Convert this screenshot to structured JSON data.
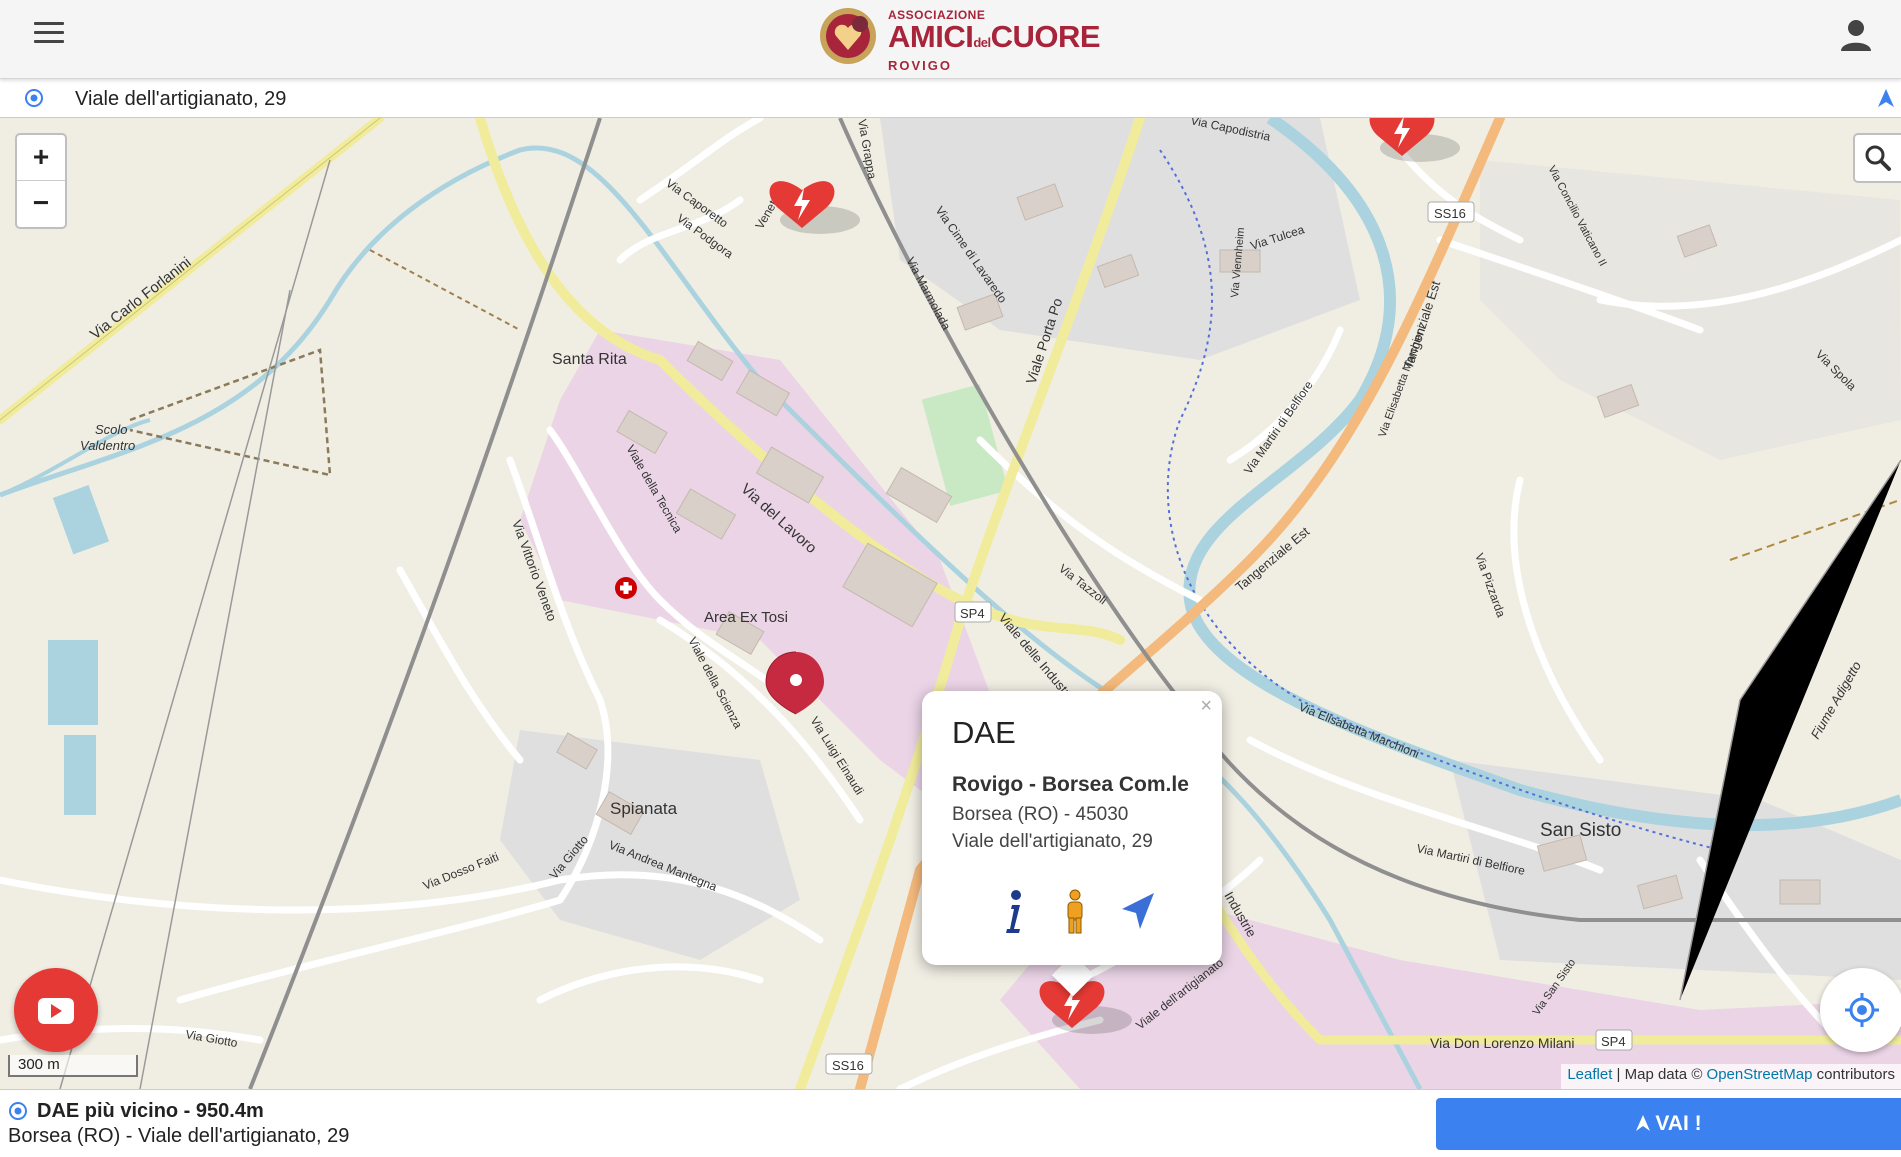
{
  "header": {
    "logo": {
      "assoc": "ASSOCIAZIONE",
      "main_left": "AMICI",
      "main_mid": "del",
      "main_right": "CUORE",
      "city": "ROVIGO"
    }
  },
  "address_bar": {
    "text": "Viale dell'artigianato, 29"
  },
  "map": {
    "controls": {
      "zoom_in": "+",
      "zoom_out": "−"
    },
    "labels": {
      "carlo_forlanini": "Via Carlo Forlanini",
      "santa_rita": "Santa Rita",
      "scolo": "Scolo",
      "valdentro": "Valdentro",
      "vittorio_veneto": "Via Vittorio Veneto",
      "caporetto": "Via Caporetto",
      "podgora": "Via Podgora",
      "grappa": "Via Grappa",
      "cime_lavaredo": "Via Cime di Lavaredo",
      "marmolada": "Via Marmolada",
      "viale_porta_po": "Viale Porta Po",
      "via_lavoro": "Via del Lavoro",
      "tecnica": "Viale della Tecnica",
      "area_ex_tosi": "Area Ex Tosi",
      "scienza": "Viale della Scienza",
      "luigi_einaudi": "Via Luigi Einaudi",
      "sp4": "SP4",
      "viale_industrie": "Viale delle Industrie",
      "via_tazzoli": "Via Tazzoli",
      "spianata": "Spianata",
      "dosso_fai": "Via Dosso Faiti",
      "giotto": "Via Giotto",
      "andrea_mantegna": "Via Andrea Mantegna",
      "via_giotto_2": "Via Giotto",
      "ss16": "SS16",
      "tangenziale_est": "Tangenziale Est",
      "tangenziale_est_2": "Tangenziale Est",
      "elisabetta_marchioni": "Via Elisabetta Marchioni",
      "elisabetta_marchioni_2": "Via Elisabetta Marchioni",
      "martiri_belfiore": "Via Martiri di Belfiore",
      "martiri_belfiore_2": "Via Martiri di Belfiore",
      "pizzarda": "Via Pizzarda",
      "san_sisto": "San Sisto",
      "san_sisto_road": "Via San Sisto",
      "spola": "Via Spola",
      "concilio": "Via Concilio Vaticano II",
      "fiume_adigetto": "Fiume Adigetto",
      "tulcea": "Via Tulcea",
      "viennheim": "Via Viennheim",
      "capodistria": "Via Capodistria",
      "don_lorenzo_milani": "Via Don Lorenzo Milani",
      "dell_artigianato": "Viale dell'artigianato",
      "industrie": "Industrie",
      "veneto": "Veneto",
      "ss16_b": "SS16",
      "sp4_b": "SP4"
    },
    "scale": "300 m",
    "attribution": {
      "leaflet": "Leaflet",
      "sep": " | Map data © ",
      "osm": "OpenStreetMap",
      "tail": " contributors"
    }
  },
  "popup": {
    "close": "×",
    "title": "DAE",
    "name": "Rovigo - Borsea Com.le",
    "line1": "Borsea (RO) - 45030",
    "line2": "Viale dell'artigianato, 29",
    "actions": [
      "info-icon",
      "person-icon",
      "navigate-icon"
    ]
  },
  "bottom": {
    "nearest_title": "DAE più vicino - 950.4m",
    "nearest_address": "Borsea (RO) - Viale dell'artigianato, 29",
    "go_button": "VAI !"
  },
  "colors": {
    "primary_red": "#e53935",
    "brand": "#a8243a",
    "go_blue": "#3b82f0",
    "marker_red": "#c62a40"
  }
}
